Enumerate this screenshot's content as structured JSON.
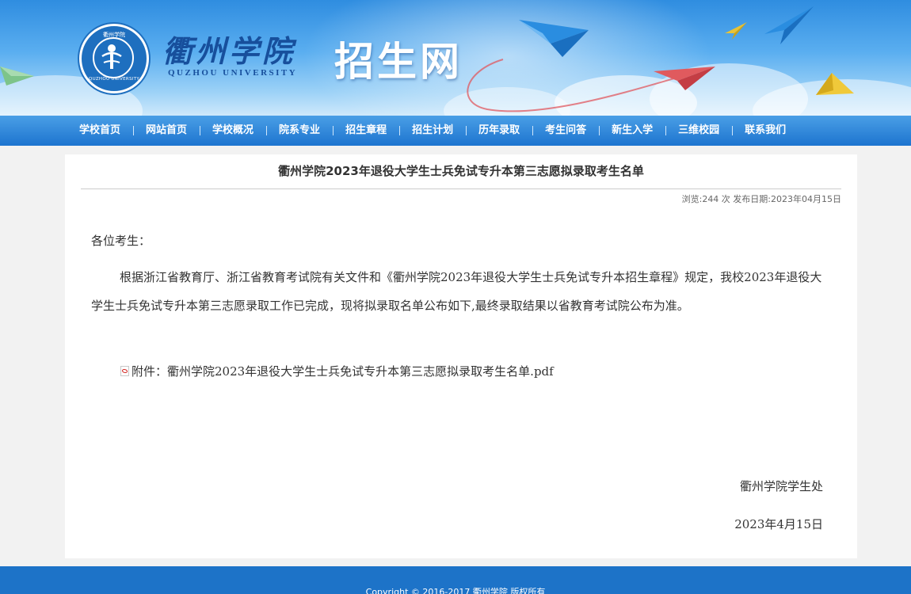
{
  "header": {
    "logo_cn": "衢州学院",
    "logo_en": "QUZHOU UNIVERSITY",
    "seal_top": "衢州学院",
    "seal_bottom": "QUZHOU UNIVERSITY",
    "site_title": "招生网"
  },
  "nav": {
    "items": [
      {
        "label": "学校首页"
      },
      {
        "label": "网站首页"
      },
      {
        "label": "学校概况"
      },
      {
        "label": "院系专业"
      },
      {
        "label": "招生章程"
      },
      {
        "label": "招生计划"
      },
      {
        "label": "历年录取"
      },
      {
        "label": "考生问答"
      },
      {
        "label": "新生入学"
      },
      {
        "label": "三维校园"
      },
      {
        "label": "联系我们"
      }
    ]
  },
  "article": {
    "title": "衢州学院2023年退役大学生士兵免试专升本第三志愿拟录取考生名单",
    "meta": "浏览:244 次 发布日期:2023年04月15日",
    "greeting": "各位考生：",
    "paragraph": "根据浙江省教育厅、浙江省教育考试院有关文件和《衢州学院2023年退役大学生士兵免试专升本招生章程》规定，我校2023年退役大学生士兵免试专升本第三志愿录取工作已完成，现将拟录取名单公布如下,最终录取结果以省教育考试院公布为准。",
    "attachment": "附件：衢州学院2023年退役大学生士兵免试专升本第三志愿拟录取考生名单.pdf",
    "signature_org": "衢州学院学生处",
    "signature_date": "2023年4月15日"
  },
  "footer": {
    "copyright": "Copyright © 2016-2017  衢州学院 版权所有"
  },
  "colors": {
    "nav_bg": "#1d74cf",
    "banner_sky": "#5aaef0",
    "logo_blue": "#174f9c",
    "footer_bg": "#1d73c8"
  },
  "icons": {
    "attachment": "pdf-icon"
  }
}
